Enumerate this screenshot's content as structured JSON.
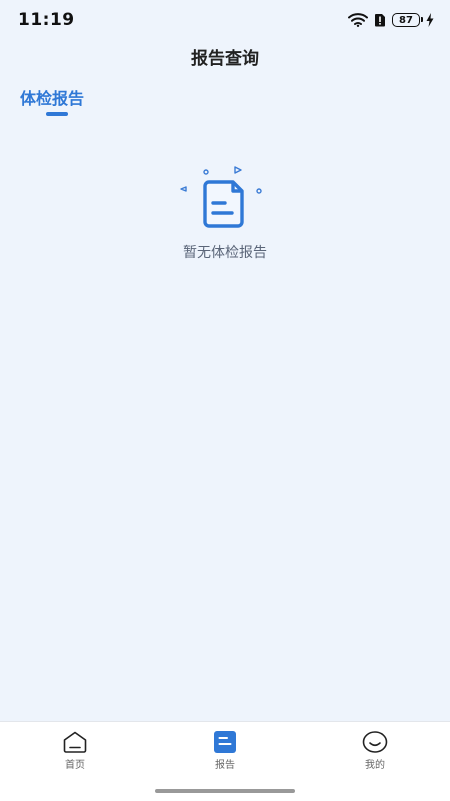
{
  "status_bar": {
    "time": "11:19",
    "battery": "87"
  },
  "header": {
    "title": "报告查询"
  },
  "tabs": [
    {
      "label": "体检报告",
      "active": true
    }
  ],
  "empty_state": {
    "message": "暂无体检报告",
    "icon": "document-icon"
  },
  "bottom_nav": {
    "items": [
      {
        "label": "首页",
        "icon": "home-icon",
        "active": false
      },
      {
        "label": "报告",
        "icon": "report-icon",
        "active": true
      },
      {
        "label": "我的",
        "icon": "smile-icon",
        "active": false
      }
    ]
  },
  "colors": {
    "accent": "#2f78d6",
    "background": "#eef4fc"
  }
}
